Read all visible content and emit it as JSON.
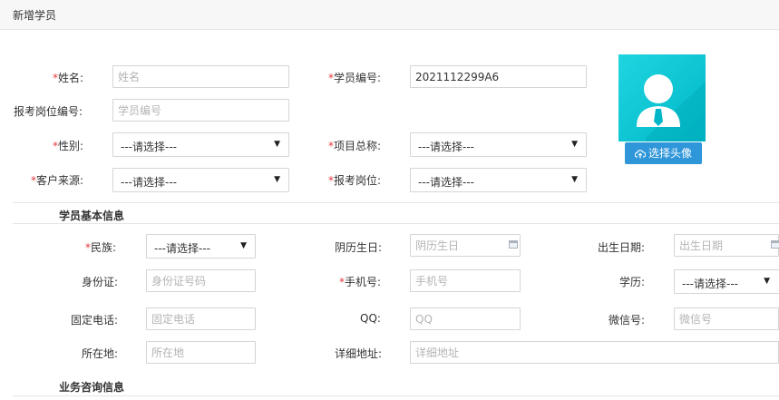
{
  "page": {
    "title": "新增学员"
  },
  "top_form": {
    "name": {
      "label": "姓名:",
      "placeholder": "姓名"
    },
    "student_no": {
      "label": "学员编号:",
      "value": "2021112299A6"
    },
    "position_no": {
      "label": "报考岗位编号:",
      "placeholder": "学员编号"
    },
    "gender": {
      "label": "性别:",
      "selected": "---请选择---"
    },
    "project": {
      "label": "项目总称:",
      "selected": "---请选择---"
    },
    "source": {
      "label": "客户来源:",
      "selected": "---请选择---"
    },
    "position": {
      "label": "报考岗位:",
      "selected": "---请选择---"
    },
    "required_mark": "*"
  },
  "avatar": {
    "icon": "user-avatar-icon",
    "upload_label": "选择头像",
    "bg_color": "#00bcd4"
  },
  "basic_info": {
    "title": "学员基本信息",
    "ethnicity": {
      "label": "民族:",
      "selected": "---请选择---"
    },
    "lunar_birthday": {
      "label": "阴历生日:",
      "placeholder": "阴历生日"
    },
    "birth_date": {
      "label": "出生日期:",
      "placeholder": "出生日期"
    },
    "id_card": {
      "label": "身份证:",
      "placeholder": "身份证号码"
    },
    "phone": {
      "label": "手机号:",
      "placeholder": "手机号"
    },
    "education": {
      "label": "学历:",
      "selected": "---请选择---"
    },
    "landline": {
      "label": "固定电话:",
      "placeholder": "固定电话"
    },
    "qq": {
      "label": "QQ:",
      "placeholder": "QQ"
    },
    "wechat": {
      "label": "微信号:",
      "placeholder": "微信号"
    },
    "location": {
      "label": "所在地:",
      "placeholder": "所在地"
    },
    "address": {
      "label": "详细地址:",
      "placeholder": "详细地址"
    }
  },
  "consult_info": {
    "title": "业务咨询信息"
  }
}
